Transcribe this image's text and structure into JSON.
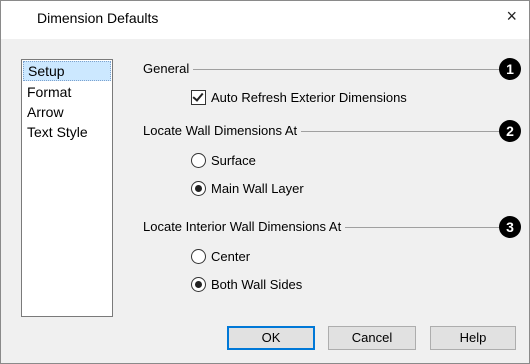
{
  "window": {
    "title": "Dimension Defaults",
    "close_glyph": "×"
  },
  "nav": {
    "items": [
      "Setup",
      "Format",
      "Arrow",
      "Text Style"
    ],
    "selected": "Setup"
  },
  "groups": [
    {
      "label": "General",
      "badge": "1"
    },
    {
      "label": "Locate Wall Dimensions At",
      "badge": "2"
    },
    {
      "label": "Locate Interior Wall Dimensions At",
      "badge": "3"
    }
  ],
  "options": {
    "auto_refresh": {
      "label": "Auto Refresh Exterior Dimensions",
      "checked": true
    },
    "wall_surface": {
      "label": "Surface",
      "selected": false
    },
    "wall_main_layer": {
      "label": "Main Wall Layer",
      "selected": true
    },
    "interior_center": {
      "label": "Center",
      "selected": false
    },
    "interior_both_sides": {
      "label": "Both Wall Sides",
      "selected": true
    }
  },
  "buttons": {
    "ok": "OK",
    "cancel": "Cancel",
    "help": "Help"
  },
  "colors": {
    "selection": "#cce8ff",
    "accent": "#0078d7"
  }
}
